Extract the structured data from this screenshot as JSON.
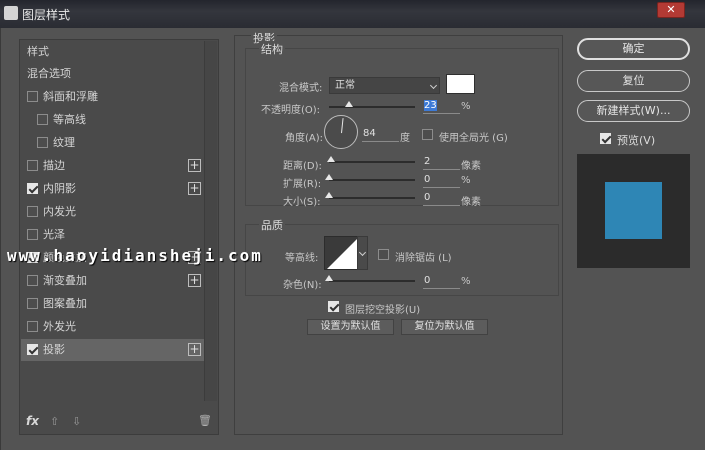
{
  "window": {
    "title": "图层样式",
    "close": "✕"
  },
  "sidebar": {
    "items": [
      {
        "label": "样式"
      },
      {
        "label": "混合选项"
      },
      {
        "label": "斜面和浮雕",
        "checked": false
      },
      {
        "label": "等高线",
        "checked": false
      },
      {
        "label": "纹理",
        "checked": false
      },
      {
        "label": "描边",
        "checked": false,
        "plus": "+"
      },
      {
        "label": "内阴影",
        "checked": true,
        "plus": "+"
      },
      {
        "label": "内发光",
        "checked": false
      },
      {
        "label": "光泽",
        "checked": false
      },
      {
        "label": "颜色叠加",
        "checked": true,
        "plus": "+"
      },
      {
        "label": "渐变叠加",
        "checked": false,
        "plus": "+"
      },
      {
        "label": "图案叠加",
        "checked": false
      },
      {
        "label": "外发光",
        "checked": false
      },
      {
        "label": "投影",
        "checked": true,
        "plus": "+",
        "selected": true
      }
    ],
    "footer": {
      "fx": "fx",
      "up": "⇧",
      "down": "⇩",
      "trash": "🗑"
    }
  },
  "panel": {
    "title": "投影",
    "structure": {
      "title": "结构",
      "blend_mode_label": "混合模式:",
      "blend_mode_value": "正常",
      "swatch_color": "#ffffff",
      "opacity_label": "不透明度(O):",
      "opacity_value": "23",
      "opacity_unit": "%",
      "angle_label": "角度(A):",
      "angle_value": "84",
      "angle_unit": "度",
      "global_light_label": "使用全局光 (G)",
      "global_light_checked": false,
      "distance_label": "距离(D):",
      "distance_value": "2",
      "distance_unit": "像素",
      "spread_label": "扩展(R):",
      "spread_value": "0",
      "spread_unit": "%",
      "size_label": "大小(S):",
      "size_value": "0",
      "size_unit": "像素"
    },
    "quality": {
      "title": "品质",
      "contour_label": "等高线:",
      "antialias_label": "消除锯齿 (L)",
      "antialias_checked": false,
      "noise_label": "杂色(N):",
      "noise_value": "0",
      "noise_unit": "%"
    },
    "knockout_label": "图层挖空投影(U)",
    "knockout_checked": true,
    "set_default": "设置为默认值",
    "reset_default": "复位为默认值"
  },
  "buttons": {
    "ok": "确定",
    "reset": "复位",
    "new_style": "新建样式(W)...",
    "preview_label": "预览(V)",
    "preview_checked": true
  },
  "preview": {
    "swatch_color": "#2e86b5"
  },
  "watermark": "www.haoyidiansheji.com"
}
